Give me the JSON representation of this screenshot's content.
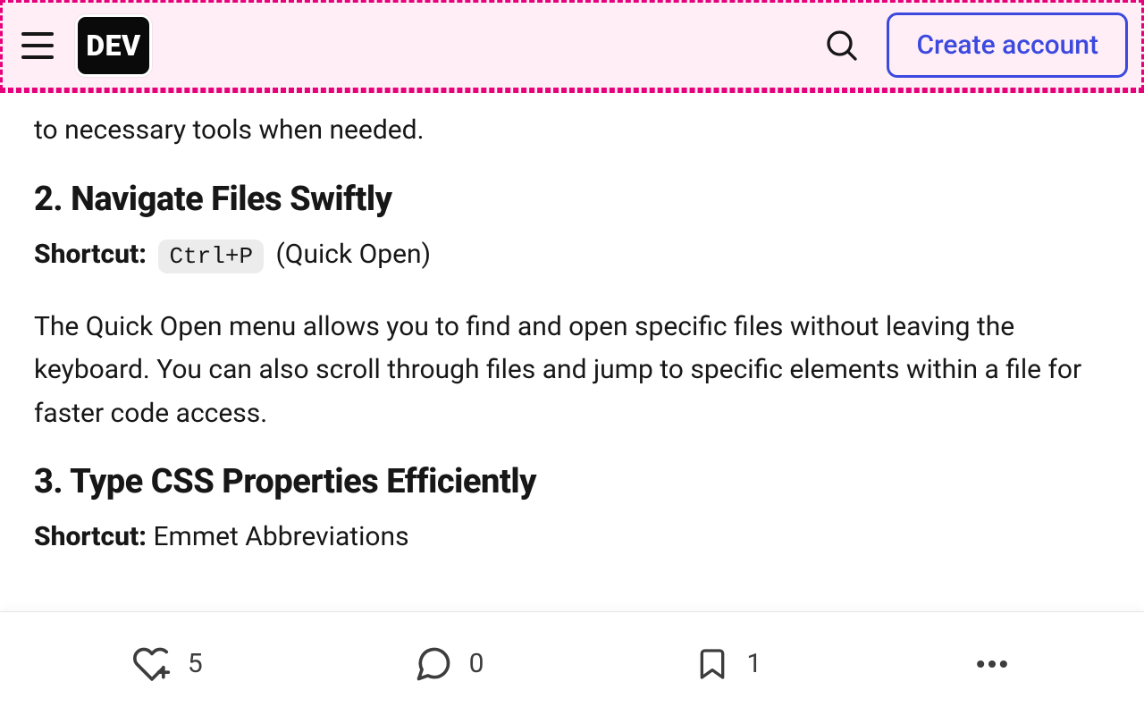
{
  "header": {
    "logo_text": "DEV",
    "create_account_label": "Create account"
  },
  "article": {
    "intro_partial": "to necessary tools when needed.",
    "section2": {
      "heading": "2. Navigate Files Swiftly",
      "shortcut_label": "Shortcut:",
      "shortcut_key": "Ctrl+P",
      "shortcut_paren": "(Quick Open)",
      "paragraph": "The Quick Open menu allows you to find and open specific files without leaving the keyboard. You can also scroll through files and jump to specific elements within a file for faster code access."
    },
    "section3": {
      "heading": "3. Type CSS Properties Efficiently",
      "shortcut_label": "Shortcut:",
      "shortcut_value": "Emmet Abbreviations"
    }
  },
  "bottom_bar": {
    "reactions_count": "5",
    "comments_count": "0",
    "bookmarks_count": "1"
  }
}
